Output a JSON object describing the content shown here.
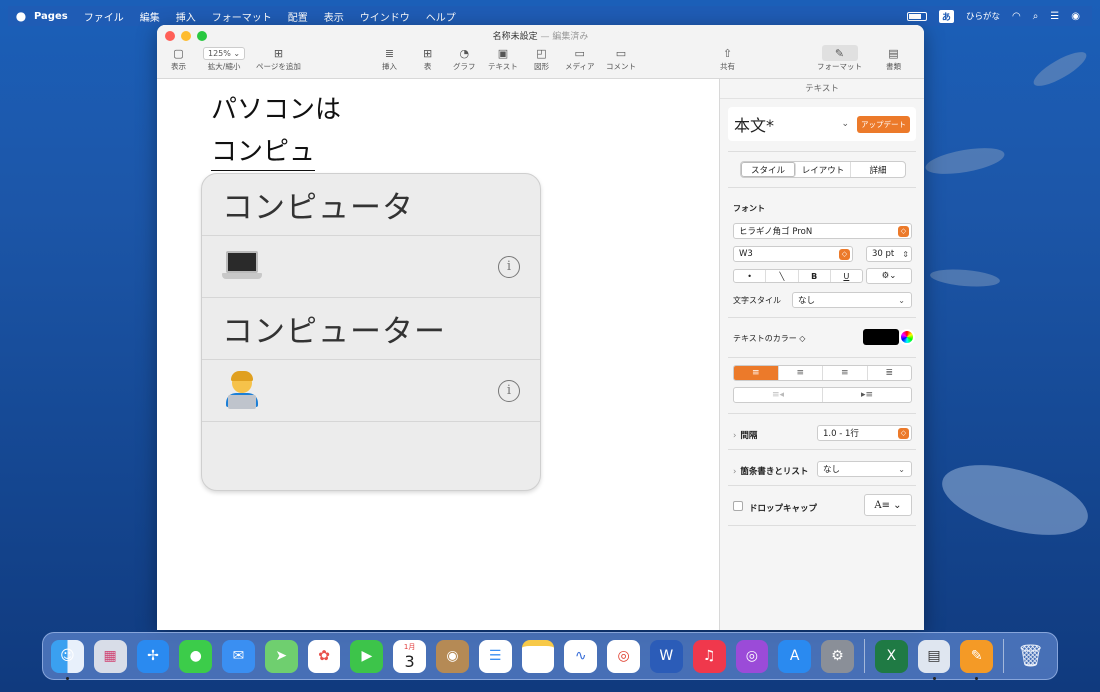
{
  "menubar": {
    "app": "Pages",
    "items": [
      "ファイル",
      "編集",
      "挿入",
      "フォーマット",
      "配置",
      "表示",
      "ウインドウ",
      "ヘルプ"
    ],
    "input_mode_box": "あ",
    "input_mode": "ひらがな"
  },
  "window": {
    "title": "名称未設定",
    "subtitle": "— 編集済み"
  },
  "toolbar": {
    "view": "表示",
    "zoom_value": "125% ⌄",
    "zoom": "拡大/縮小",
    "add_page": "ページを追加",
    "insert": "挿入",
    "table": "表",
    "chart": "グラフ",
    "text": "テキスト",
    "shape": "図形",
    "media": "メディア",
    "comment": "コメント",
    "share": "共有",
    "format": "フォーマット",
    "document": "書類"
  },
  "document": {
    "line1": "パソコンは",
    "line2": "コンピュ"
  },
  "suggestions": [
    {
      "text": "コンピュータ"
    },
    {
      "emoji": "laptop",
      "info": "i"
    },
    {
      "text": "コンピューター"
    },
    {
      "emoji": "technologist",
      "info": "i"
    }
  ],
  "sidebar": {
    "header": "テキスト",
    "paragraph_style": "本文*",
    "update_button": "アップデート",
    "tabs": [
      "スタイル",
      "レイアウト",
      "詳細"
    ],
    "font_label": "フォント",
    "font_name": "ヒラギノ角ゴ ProN",
    "font_weight": "W3",
    "font_size": "30 pt",
    "char_style_label": "文字スタイル",
    "char_style_value": "なし",
    "text_color_label": "テキストのカラー ◇",
    "spacing_label": "間隔",
    "spacing_value": "1.0 - 1行",
    "bullets_label": "箇条書きとリスト",
    "bullets_value": "なし",
    "dropcap_label": "ドロップキャップ",
    "accent_color": "#ec7a2a"
  },
  "dock": {
    "calendar_month": "1月",
    "calendar_day": "3"
  }
}
